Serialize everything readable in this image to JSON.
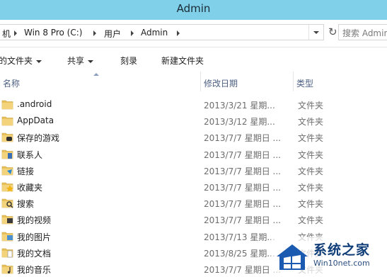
{
  "window": {
    "title": "Admin"
  },
  "address": {
    "crumbs": [
      "机",
      "Win 8 Pro (C:)",
      "用户",
      "Admin"
    ],
    "search_placeholder": "搜索 Admin"
  },
  "toolbar": {
    "include_label": "的文件夹",
    "share_label": "共享",
    "burn_label": "刻录",
    "new_folder_label": "新建文件夹"
  },
  "columns": {
    "name": "名称",
    "date": "修改日期",
    "type": "类型"
  },
  "files": [
    {
      "name": ".android",
      "date": "2013/3/21 星期...",
      "type": "文件夹",
      "icon": "folder-icon"
    },
    {
      "name": "AppData",
      "date": "2013/3/12 星期...",
      "type": "文件夹",
      "icon": "folder-icon"
    },
    {
      "name": "保存的游戏",
      "date": "2013/7/7 星期日 ...",
      "type": "文件夹",
      "icon": "saved-games-icon"
    },
    {
      "name": "联系人",
      "date": "2013/7/7 星期日 ...",
      "type": "文件夹",
      "icon": "contacts-icon"
    },
    {
      "name": "链接",
      "date": "2013/7/7 星期日 ...",
      "type": "文件夹",
      "icon": "links-icon"
    },
    {
      "name": "收藏夹",
      "date": "2013/7/7 星期日 ...",
      "type": "文件夹",
      "icon": "favorites-icon"
    },
    {
      "name": "搜索",
      "date": "2013/7/7 星期日 ...",
      "type": "文件夹",
      "icon": "searches-icon"
    },
    {
      "name": "我的视频",
      "date": "2013/7/7 星期日 ...",
      "type": "文件夹",
      "icon": "videos-icon"
    },
    {
      "name": "我的图片",
      "date": "2013/7/13 星期...",
      "type": "文件夹",
      "icon": "pictures-icon"
    },
    {
      "name": "我的文档",
      "date": "2013/8/25 星期...",
      "type": "文件夹",
      "icon": "documents-icon"
    },
    {
      "name": "我的音乐",
      "date": "2013/7/7 星期日 ...",
      "type": "文件夹",
      "icon": "music-icon"
    }
  ],
  "watermark": {
    "title": "系统之家",
    "url": "Win10net.com"
  },
  "colors": {
    "titlebar": "#7fd0e8",
    "folder": "#e8c15a",
    "header_text": "#4d6082"
  }
}
